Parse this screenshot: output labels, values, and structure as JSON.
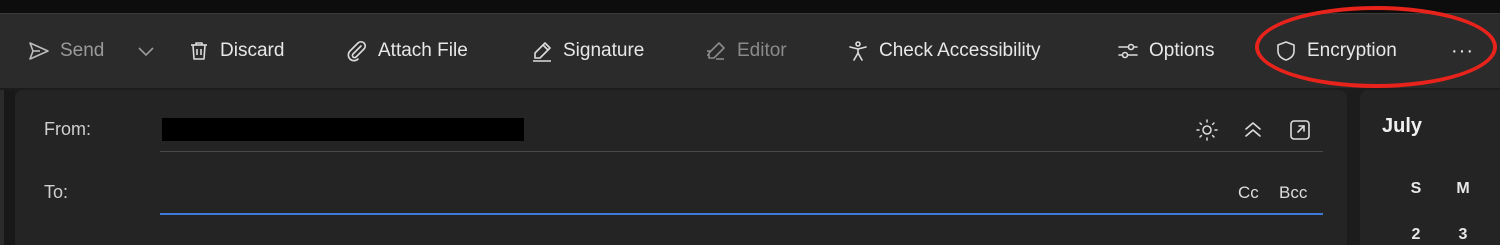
{
  "toolbar": {
    "send_label": "Send",
    "discard_label": "Discard",
    "attach_label": "Attach File",
    "signature_label": "Signature",
    "editor_label": "Editor",
    "accessibility_label": "Check Accessibility",
    "options_label": "Options",
    "encryption_label": "Encryption",
    "more_label": "···"
  },
  "compose": {
    "from_label": "From:",
    "to_label": "To:",
    "cc_label": "Cc",
    "bcc_label": "Bcc"
  },
  "calendar": {
    "month": "July",
    "weekday_headers": [
      "S",
      "M"
    ],
    "first_row": [
      "2",
      "3"
    ]
  },
  "colors": {
    "annotation": "#e8231c",
    "focus_underline": "#3d7bd6"
  }
}
